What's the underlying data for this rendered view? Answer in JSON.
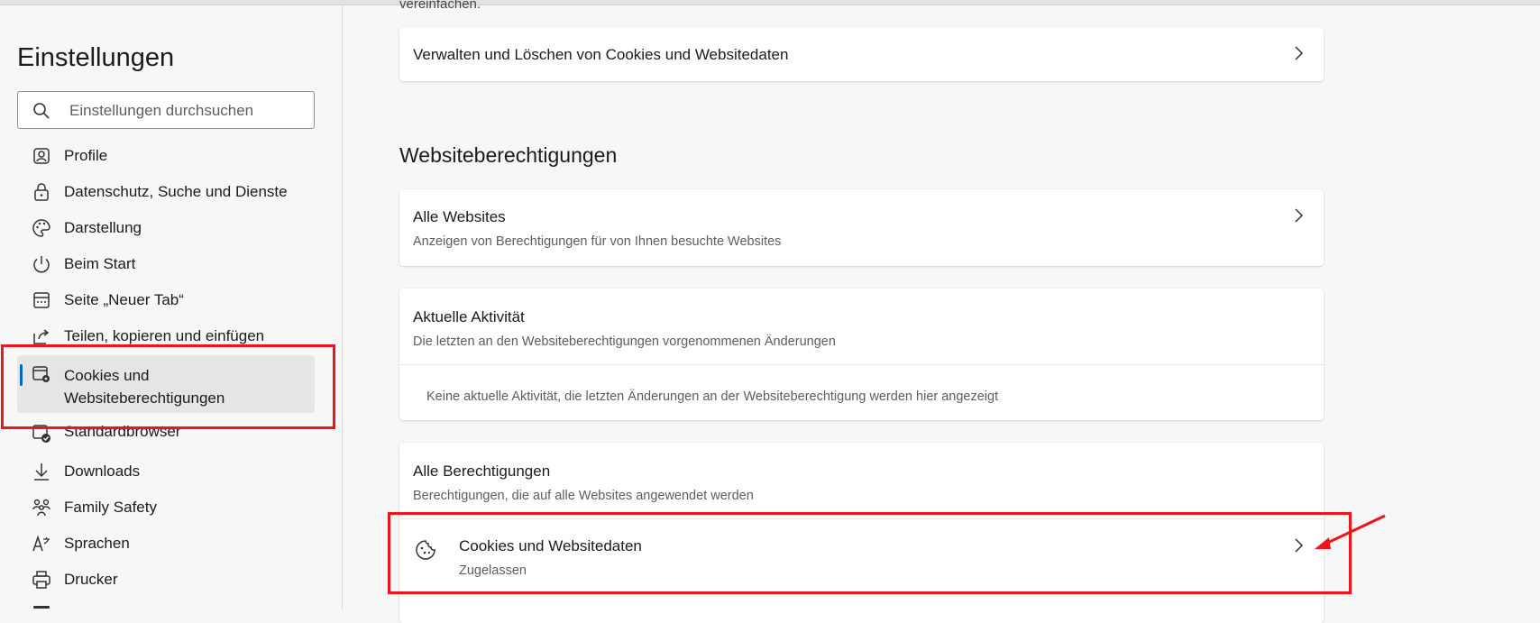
{
  "sidebar": {
    "title": "Einstellungen",
    "search_placeholder": "Einstellungen durchsuchen",
    "items": [
      {
        "label": "Profile",
        "icon": "profile-icon"
      },
      {
        "label": "Datenschutz, Suche und Dienste",
        "icon": "lock-icon"
      },
      {
        "label": "Darstellung",
        "icon": "palette-icon"
      },
      {
        "label": "Beim Start",
        "icon": "power-icon"
      },
      {
        "label": "Seite „Neuer Tab“",
        "icon": "new-tab-icon"
      },
      {
        "label": "Teilen, kopieren und einfügen",
        "icon": "share-icon"
      },
      {
        "label": "Cookies und\nWebsiteberechtigungen",
        "icon": "cookie-settings-icon",
        "active": true
      },
      {
        "label": "Standardbrowser",
        "icon": "browser-icon"
      },
      {
        "label": "Downloads",
        "icon": "download-icon"
      },
      {
        "label": "Family Safety",
        "icon": "family-icon"
      },
      {
        "label": "Sprachen",
        "icon": "language-icon"
      },
      {
        "label": "Drucker",
        "icon": "printer-icon"
      }
    ]
  },
  "main": {
    "cutoff_text": "vereinfachen.",
    "manage_cookies": {
      "title": "Verwalten und Löschen von Cookies und Websitedaten"
    },
    "section_title": "Websiteberechtigungen",
    "all_websites": {
      "title": "Alle Websites",
      "subtitle": "Anzeigen von Berechtigungen für von Ihnen besuchte Websites"
    },
    "recent_activity": {
      "title": "Aktuelle Aktivität",
      "subtitle": "Die letzten an den Websiteberechtigungen vorgenommenen Änderungen",
      "empty_text": "Keine aktuelle Aktivität, die letzten Änderungen an der Websiteberechtigung werden hier angezeigt"
    },
    "all_permissions": {
      "title": "Alle Berechtigungen",
      "subtitle": "Berechtigungen, die auf alle Websites angewendet werden",
      "cookies_row": {
        "title": "Cookies und Websitedaten",
        "status": "Zugelassen",
        "icon": "cookie-icon"
      }
    }
  },
  "colors": {
    "accent": "#0067c0",
    "annotation": "#f0141a"
  }
}
